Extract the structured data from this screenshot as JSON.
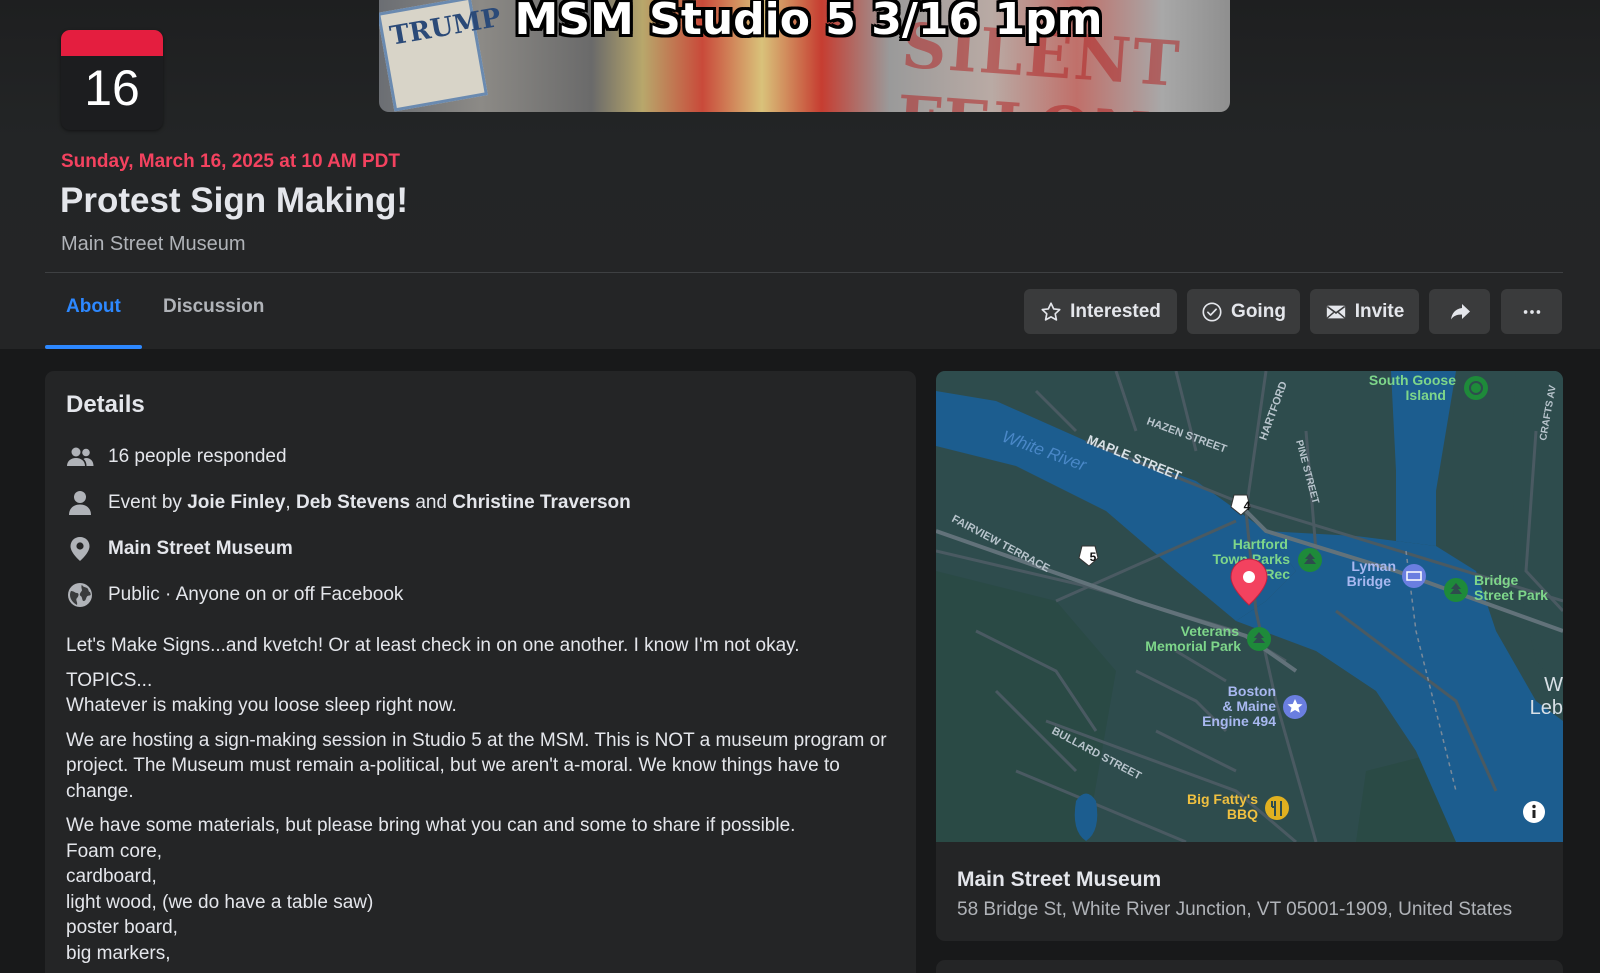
{
  "cover": {
    "title": "MSM Studio 5  3/16  1pm",
    "sign_trump": "TRUMP",
    "sign_silent": "SILENT FELON"
  },
  "calendar": {
    "day": "16"
  },
  "event": {
    "date": "Sunday, March 16, 2025 at 10 AM PDT",
    "title": "Protest Sign Making!",
    "host": "Main Street Museum"
  },
  "tabs": [
    {
      "label": "About",
      "active": true
    },
    {
      "label": "Discussion",
      "active": false
    }
  ],
  "actions": {
    "interested": "Interested",
    "going": "Going",
    "invite": "Invite",
    "share_icon": "share-icon",
    "more_icon": "more-icon"
  },
  "details": {
    "heading": "Details",
    "responded": "16 people responded",
    "event_by_prefix": "Event by ",
    "host1": "Joie Finley",
    "sep1": ", ",
    "host2": "Deb Stevens",
    "sep2": " and ",
    "host3": "Christine Traverson",
    "location": "Main Street Museum",
    "privacy": "Public · Anyone on or off Facebook",
    "description": [
      "Let's Make Signs...and kvetch! Or at least check in on one another. I know I'm not okay.",
      "TOPICS...",
      "Whatever is making you loose sleep right now.",
      "We are hosting a sign-making session in Studio 5 at the MSM. This is NOT a museum program or project. The Museum must remain a-political, but we aren't a-moral. We know things have to change.",
      "We have some materials, but please bring what you can and some to share if possible.",
      "Foam core,",
      "cardboard,",
      "light wood, (we do have a table saw)",
      "poster board,",
      "big markers,"
    ]
  },
  "map": {
    "labels": {
      "south_goose_1": "South Goose",
      "south_goose_2": "Island",
      "hazen": "HAZEN STREET",
      "maple": "MAPLE STREET",
      "white_river": "White River",
      "hartford": "HARTFORD",
      "pine": "PINE STREET",
      "crafts": "CRAFTS AV",
      "fairview": "FAIRVIEW TERRACE",
      "hartford_parks_1": "Hartford",
      "hartford_parks_2": "Town Parks",
      "hartford_parks_3": "Rec",
      "lyman_1": "Lyman",
      "lyman_2": "Bridge",
      "bridge_park_1": "Bridge",
      "bridge_park_2": "Street Park",
      "veterans_1": "Veterans",
      "veterans_2": "Memorial Park",
      "boston_1": "Boston",
      "boston_2": "& Maine",
      "boston_3": "Engine 494",
      "bullard": "BULLARD STREET",
      "bigfatty_1": "Big Fatty's",
      "bigfatty_2": "BBQ",
      "w_leb_1": "W",
      "w_leb_2": "Leb",
      "route4": "4",
      "route5": "5"
    },
    "place_name": "Main Street Museum",
    "address": "58 Bridge St, White River Junction, VT 05001-1909, United States"
  },
  "colors": {
    "accent": "#2d88ff",
    "date_red": "#f3425f",
    "water": "#1c5d8f",
    "land": "#2d4b4c",
    "park_green": "#1e8a3a"
  }
}
